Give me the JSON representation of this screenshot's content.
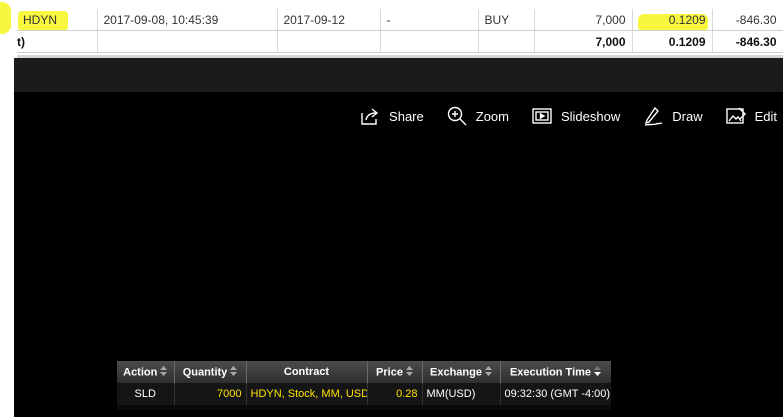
{
  "trade_row": {
    "symbol": "HDYN",
    "datetime": "2017-09-08, 10:45:39",
    "settle_date": "2017-09-12",
    "dash": "-",
    "side": "BUY",
    "quantity": "7,000",
    "price": "0.1209",
    "amount": "-846.30"
  },
  "total_row": {
    "label": "t)",
    "quantity": "7,000",
    "price": "0.1209",
    "amount": "-846.30"
  },
  "toolbar": {
    "share": "Share",
    "zoom": "Zoom",
    "slideshow": "Slideshow",
    "draw": "Draw",
    "edit": "Edit"
  },
  "executions": {
    "headers": {
      "action": "Action",
      "quantity": "Quantity",
      "contract": "Contract",
      "price": "Price",
      "exchange": "Exchange",
      "execution_time": "Execution Time"
    },
    "rows": [
      {
        "action": "SLD",
        "quantity": "7000",
        "contract": "HDYN, Stock, MM, USD",
        "price": "0.28",
        "exchange": "MM(USD)",
        "execution_time": "09:32:30 (GMT -4:00)"
      }
    ]
  },
  "colors": {
    "highlight": "#f7f73f",
    "exec_value": "#ffe400",
    "viewer_bg": "#000000"
  }
}
